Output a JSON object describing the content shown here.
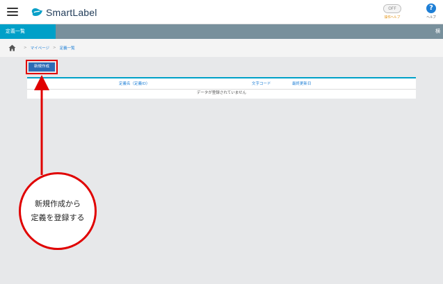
{
  "header": {
    "logo_text": "SmartLabel",
    "help_toggle": {
      "state": "OFF",
      "caption": "操作ヘルプ"
    },
    "help_button": {
      "symbol": "?",
      "caption": "ヘルプ"
    }
  },
  "titlebar": {
    "tab_label": "定義一覧",
    "right_text": "横"
  },
  "breadcrumb": {
    "items": [
      "マイページ",
      "定義一覧"
    ],
    "separator": ">"
  },
  "toolbar": {
    "new_label": "新規作成"
  },
  "table": {
    "columns": [
      "定義名（定義ID）",
      "文字コード",
      "最終更新日"
    ],
    "empty_message": "データが登録されていません"
  },
  "annotation": {
    "lines": [
      "新規作成から",
      "定義を登録する"
    ],
    "color": "#e00000"
  },
  "colors": {
    "accent": "#00a0c8",
    "header_bar": "#78909c",
    "button": "#2d6cb5",
    "link": "#1e7fd6"
  }
}
